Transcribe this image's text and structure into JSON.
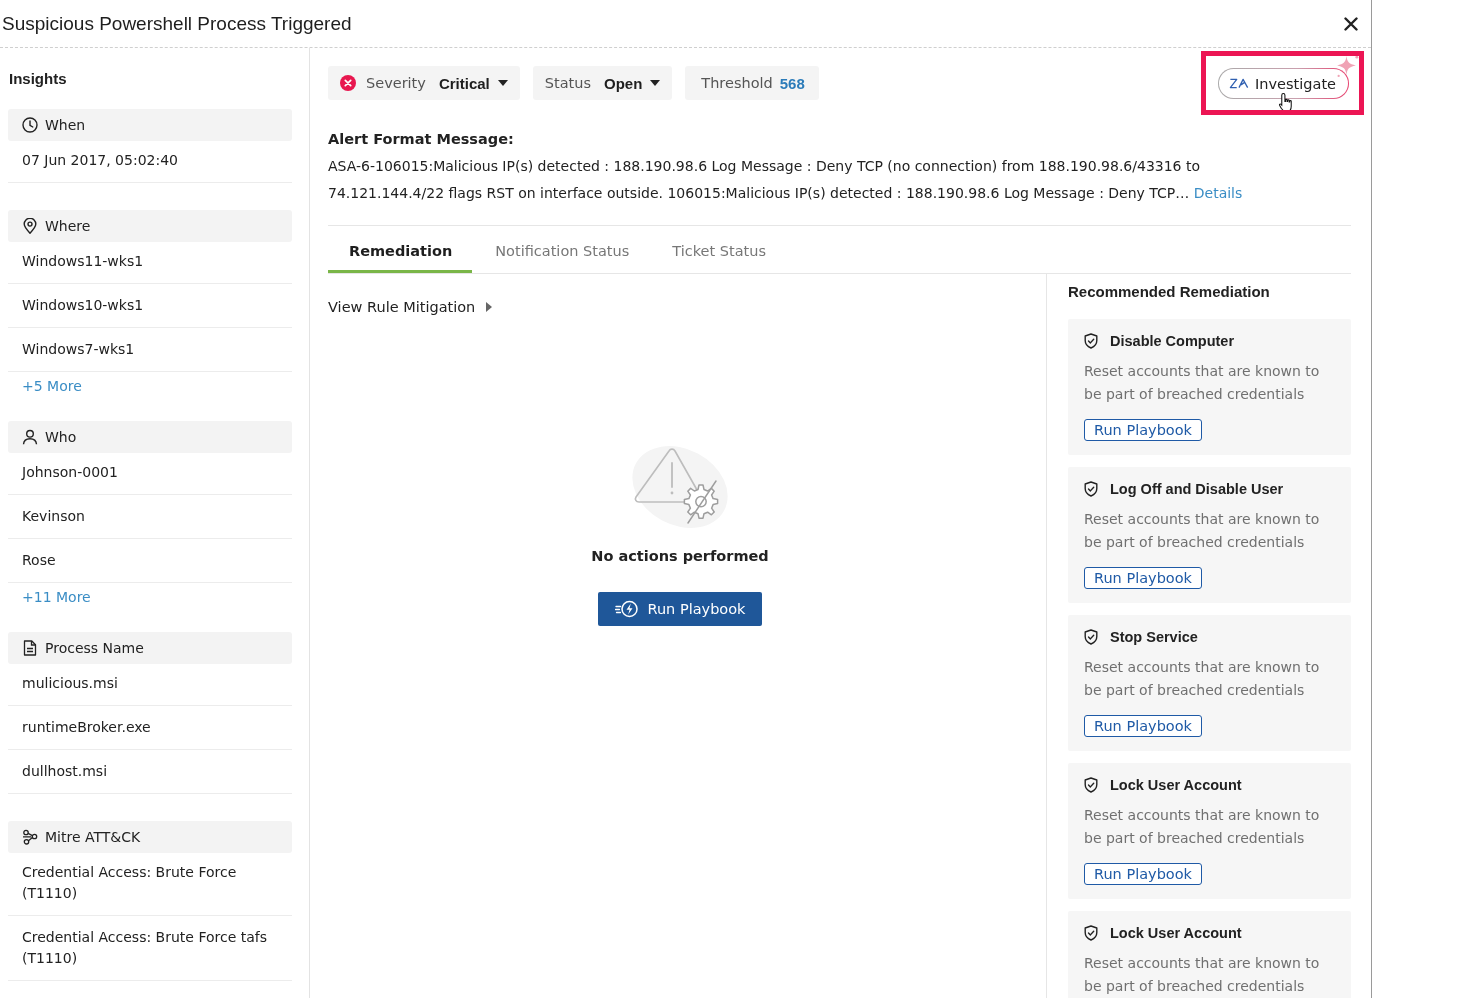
{
  "window": {
    "title": "Suspicious Powershell Process Triggered"
  },
  "sidebar": {
    "title": "Insights",
    "sections": [
      {
        "kind": "when",
        "label": "When",
        "values": [
          "07 Jun 2017, 05:02:40"
        ]
      },
      {
        "kind": "where",
        "label": "Where",
        "values": [
          "Windows11-wks1",
          "Windows10-wks1",
          "Windows7-wks1"
        ],
        "more": "+5 More"
      },
      {
        "kind": "who",
        "label": "Who",
        "values": [
          "Johnson-0001",
          "Kevinson",
          "Rose"
        ],
        "more": "+11 More"
      },
      {
        "kind": "process",
        "label": "Process Name",
        "values": [
          "mulicious.msi",
          "runtimeBroker.exe",
          "dullhost.msi"
        ]
      },
      {
        "kind": "mitre",
        "label": "Mitre ATT&CK",
        "values": [
          "Credential Access: Brute Force (T1110)",
          "Credential Access: Brute Force tafs (T1110)"
        ]
      }
    ]
  },
  "header": {
    "chips": [
      {
        "kind": "severity",
        "label": "Severity",
        "value": "Critical"
      },
      {
        "kind": "status",
        "label": "Status",
        "value": "Open"
      },
      {
        "kind": "threshold",
        "label": "Threshold",
        "value": "568"
      }
    ],
    "investigate": "Investigate"
  },
  "alert": {
    "heading": "Alert Format Message:",
    "message": "ASA-6-106015:Malicious IP(s) detected : 188.190.98.6 Log Message : Deny TCP (no connection) from 188.190.98.6/43316 to 74.121.144.4/22 flags RST on interface outside. 106015:Malicious IP(s) detected : 188.190.98.6 Log Message : Deny TCP…",
    "link": "Details"
  },
  "tabs": [
    {
      "label": "Remediation",
      "selected": true
    },
    {
      "label": "Notification Status",
      "selected": false
    },
    {
      "label": "Ticket Status",
      "selected": false
    }
  ],
  "mitigation": {
    "label": "View Rule Mitigation",
    "expanded": false
  },
  "empty_state": {
    "message": "No actions performed",
    "button": "Run Playbook"
  },
  "recommended": {
    "title": "Recommended Remediation",
    "cards": [
      {
        "title": "Disable Computer",
        "description": "Reset accounts that are known to be part of breached credentials",
        "button": "Run Playbook"
      },
      {
        "title": "Log Off and Disable User",
        "description": "Reset accounts that are known to be part of breached credentials",
        "button": "Run Playbook"
      },
      {
        "title": "Stop Service",
        "description": "Reset accounts that are known to be part of breached credentials",
        "button": "Run Playbook"
      },
      {
        "title": "Lock User Account",
        "description": "Reset accounts that are known to be part of breached credentials",
        "button": "Run Playbook"
      },
      {
        "title": "Lock User Account",
        "description": "Reset accounts that are known to be part of breached credentials"
      }
    ]
  }
}
